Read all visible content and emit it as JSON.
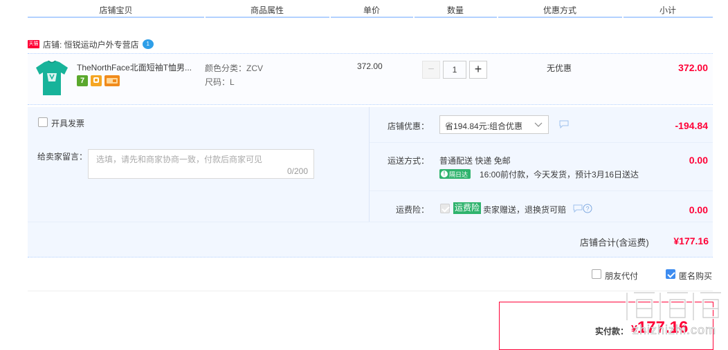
{
  "header": {
    "col_shop_item": "店铺宝贝",
    "col_attr": "商品属性",
    "col_price": "单价",
    "col_qty": "数量",
    "col_discount": "优惠方式",
    "col_subtotal": "小计"
  },
  "shop": {
    "badge": "天猫",
    "name": "店铺: 恒锐运动户外专营店",
    "chat_badge": "1"
  },
  "item": {
    "title": "TheNorthFace北面短袖T恤男...",
    "attr_color": "颜色分类：ZCV",
    "attr_size": "尺码：L",
    "price": "372.00",
    "qty_minus": "−",
    "qty": "1",
    "qty_plus": "+",
    "discount": "无优惠",
    "subtotal": "372.00",
    "tags": [
      {
        "icon": "seven-day-return-icon",
        "char": "7",
        "color": "#5aa82d"
      },
      {
        "icon": "guarantee-icon",
        "char": "",
        "color": "#f5a623"
      },
      {
        "icon": "card-pay-icon",
        "char": "",
        "color": "#f08b1c"
      }
    ]
  },
  "invoice": {
    "label": "开具发票"
  },
  "message": {
    "label": "给卖家留言：",
    "placeholder": "选填，请先和商家协商一致，付款后商家可见",
    "counter": "0/200"
  },
  "shop_discount": {
    "label": "店铺优惠：",
    "select_value": "省194.84元:组合优惠",
    "amount": "-194.84"
  },
  "shipping": {
    "label": "运送方式：",
    "method": "普通配送 快递 免邮",
    "badge": "隔日达",
    "note": "16:00前付款，今天发货，预计3月16日送达",
    "amount": "0.00"
  },
  "insurance": {
    "label": "运费险：",
    "badge": "运费险",
    "text": "卖家赠送，退换货可赔",
    "amount": "0.00"
  },
  "shop_total": {
    "label": "店铺合计(含运费)",
    "amount": "¥177.16"
  },
  "options": {
    "friend_pay": "朋友代付",
    "anonymous": "匿名购买"
  },
  "pay": {
    "label": "实付款：",
    "currency": "¥",
    "amount": "177.16"
  },
  "watermark": "值值值 zhizhizhi.com",
  "colors": {
    "accent_red": "#ff0036",
    "panel_bg": "#f2f7ff",
    "header_line": "#b2d1ff"
  }
}
